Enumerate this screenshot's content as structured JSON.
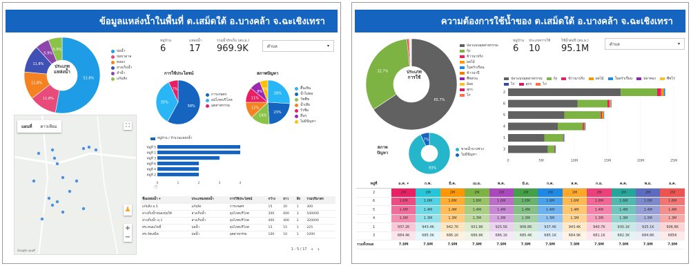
{
  "left": {
    "title": "ข้อมูลแหล่งน้ำในพื้นที่ ต.เสม็ดใต้ อ.บางคล้า จ.ฉะเชิงเทรา",
    "kpis": [
      {
        "label": "หมู่บ้าน",
        "value": "6"
      },
      {
        "label": "แหล่งน้ำ",
        "value": "17"
      },
      {
        "label": "รวมน้ำกักเก็บ (ลบ.ม.)",
        "value": "969.9K"
      }
    ],
    "filter_label": "ตำบล",
    "donut": {
      "center": [
        "ประเภท",
        "แหล่งน้ำ"
      ],
      "legend": [
        "บ่อน้ำ",
        "บ่อบาดาล",
        "คลอง",
        "อ่างเก็บน้ำ",
        "ลำน้ำ",
        "แก้มลิง"
      ],
      "colors": [
        "#1e9de6",
        "#e84a7a",
        "#f58220",
        "#3f51b5",
        "#8e44ad",
        "#8bc34a"
      ],
      "values": [
        52.9,
        11.8,
        11.8,
        11.8,
        5.9,
        5.9
      ]
    },
    "pie_use": {
      "title": "การใช้ประโยชน์",
      "legend": [
        "การเกษตร",
        "อุปโภคบริโภค",
        "อุตสาหกรรม"
      ],
      "colors": [
        "#1565c0",
        "#29b6f6",
        "#e91e63"
      ],
      "values": [
        58,
        35,
        7
      ]
    },
    "pie_problem": {
      "title": "สภาพปัญหา",
      "legend": [
        "ตื้นเขิน",
        "น้ำไม่พอ",
        "วัชพืช",
        "น้ำเสีย",
        "รั่วซึม",
        "อื่นๆ",
        "ไม่มีปัญหา"
      ],
      "colors": [
        "#29b6f6",
        "#1565c0",
        "#8bc34a",
        "#f58220",
        "#e91e63",
        "#9c27b0",
        "#ffc107"
      ],
      "values": [
        26,
        23,
        14,
        12,
        11,
        8,
        6
      ]
    },
    "bar": {
      "legend": "หมู่บ้าน / จำนวนแหล่งน้ำ",
      "categories": [
        "หมู่ที่ 5",
        "หมู่ที่ 1",
        "หมู่ที่ 3",
        "หมู่ที่ 6",
        "หมู่ที่ 4",
        "หมู่ที่ 2"
      ],
      "values": [
        4,
        4,
        3,
        2,
        2,
        2
      ],
      "ticks": [
        "0",
        "1",
        "2",
        "3",
        "4"
      ]
    },
    "map": {
      "tab_map": "แผนที่",
      "tab_sat": "ดาวเทียม",
      "footer": "Google แผนที่"
    },
    "table": {
      "headers": [
        "ชื่อแหล่งน้ำ ▾",
        "ประเภทแหล่งน้ำ",
        "การใช้ประโยชน์",
        "กว้าง",
        "ยาว",
        "ลึก",
        "รวมปริมาตร"
      ],
      "rows": [
        [
          "แก้มลิง ม.5",
          "แก้มลิง",
          "การเกษตร",
          "15",
          "20",
          "1",
          "300"
        ],
        [
          "อ่างเก็บน้ำหนองกุ่มใต้",
          "อ่างเก็บน้ำ",
          "อุปโภคบริโภค",
          "300",
          "600",
          "3",
          "540000"
        ],
        [
          "อ่างเก็บน้ำ ม.1",
          "อ่างเก็บน้ำ",
          "อุปโภคบริโภค",
          "400",
          "400",
          "2",
          "320000"
        ],
        [
          "สระหนองโพธิ์",
          "บ่อน้ำ",
          "อุปโภคบริโภค",
          "15",
          "15",
          "1",
          "225"
        ],
        [
          "สระวัดเสม็ด",
          "บ่อน้ำ",
          "อุตสาหกรรม",
          "100",
          "10",
          "1",
          "1000"
        ]
      ],
      "pager": "1 - 5 / 17"
    }
  },
  "right": {
    "title": "ความต้องการใช้น้ำของ ต.เสม็ดใต้ อ.บางคล้า จ.ฉะเชิงเทรา",
    "kpis": [
      {
        "label": "หมู่บ้าน",
        "value": "6"
      },
      {
        "label": "ประเภทการใช้",
        "value": "10"
      },
      {
        "label": "ใช้น้ำต่อปี (ลบ.ม.)",
        "value": "95.1M"
      }
    ],
    "filter_label": "ตำบล",
    "donut": {
      "center": [
        "ประเภท",
        "การใช้"
      ],
      "legend": [
        "ปลาแบบอุตสาหกรรม",
        "กุ้ง",
        "ข้าวนาปรัง",
        "ผลไม้",
        "ในครัวเรือน",
        "ข้าวนาปี",
        "พืชสวน",
        "อ้อย",
        "สุกร",
        "ไก่"
      ],
      "colors": [
        "#616161",
        "#7cb342",
        "#e91e63",
        "#ff9800",
        "#1e88e5",
        "#f57c00",
        "#8e24aa",
        "#fbc02d",
        "#d81b60",
        "#ff7043"
      ],
      "values": [
        65.7,
        32.7,
        0.6,
        0.4,
        0.2,
        0.1,
        0.1,
        0.1,
        0.05,
        0.05
      ]
    },
    "problem": {
      "center": [
        "สภาพ",
        "ปัญหา"
      ],
      "legend": [
        "ขาดน้ำบางช่วง",
        "ไม่มีปัญหา"
      ],
      "colors": [
        "#26b6cc",
        "#1565c0"
      ],
      "values": [
        93,
        7
      ]
    },
    "stack": {
      "categories": [
        "2",
        "6",
        "5",
        "4",
        "1",
        "3"
      ],
      "series": [
        {
          "name": "ปลาแบบอุตสาหกรรม",
          "values": [
            17,
            10.5,
            8.5,
            7.5,
            5.5,
            6
          ]
        },
        {
          "name": "กุ้ง",
          "values": [
            5.5,
            4.5,
            5.5,
            3.8,
            2.8,
            1.0
          ]
        },
        {
          "name": "ข้าวนาปรัง",
          "values": [
            0.6,
            0.3,
            0.2,
            0.2,
            0.1,
            0.1
          ]
        },
        {
          "name": "ผลไม้",
          "values": [
            0.4,
            0.2,
            0.2,
            0.1,
            0.0,
            0.0
          ]
        },
        {
          "name": "ในครัวเรือน",
          "values": [
            0.2,
            0.1,
            0.1,
            0.1,
            0.1,
            0.1
          ]
        }
      ],
      "legend": [
        "ปลาแบบอุตสาหกรรม",
        "กุ้ง",
        "ข้าวนาปรัง",
        "ผลไม้",
        "ในครัวเรือน",
        "ปลาทอง",
        "พืชไร่",
        "ไก่",
        "สุกร",
        "ไก่"
      ],
      "legend_colors": [
        "#616161",
        "#7cb342",
        "#e91e63",
        "#ff9800",
        "#1e88e5",
        "#8e24aa",
        "#fbc02d",
        "#3949ab",
        "#d81b60",
        "#ff7043"
      ],
      "colors": [
        "#616161",
        "#7cb342",
        "#e91e63",
        "#ff9800",
        "#1e88e5"
      ],
      "ticks": [
        "0",
        "5M",
        "10M",
        "15M",
        "20M",
        "25M"
      ],
      "xlim": [
        0,
        25
      ]
    },
    "monthly": {
      "headers": [
        "หมู่ที่",
        "ม.ค. ▾",
        "ก.พ.",
        "มี.ค.",
        "เม.ย.",
        "พ.ค.",
        "มิ.ย.",
        "ก.ค.",
        "ส.ค.",
        "ก.ย.",
        "ต.ค.",
        "พ.ย.",
        "ธ.ค."
      ],
      "rows": [
        {
          "id": "2",
          "vals": [
            "2M",
            "2M",
            "2M",
            "2M",
            "2M",
            "2M",
            "2M",
            "2M",
            "2M",
            "2M",
            "2M",
            "2M"
          ]
        },
        {
          "id": "6",
          "vals": [
            "1.6M",
            "1.6M",
            "1.6M",
            "1.6M",
            "1.6M",
            "1.6M",
            "1.6M",
            "1.6M",
            "1.6M",
            "1.6M",
            "1.6M",
            "1.6M"
          ]
        },
        {
          "id": "5",
          "vals": [
            "1.4M",
            "1.4M",
            "1.4M",
            "1.4M",
            "1.4M",
            "1.4M",
            "1.4M",
            "1.4M",
            "1.4M",
            "1.4M",
            "1.4M",
            "1.4M"
          ]
        },
        {
          "id": "4",
          "vals": [
            "1.3M",
            "1.3M",
            "1.3M",
            "1.3M",
            "1.3M",
            "1.3M",
            "1.3M",
            "1.3M",
            "1.3M",
            "1.3M",
            "1.3M",
            "1.3M"
          ]
        },
        {
          "id": "1",
          "vals": [
            "937.2K",
            "943.4K",
            "942.7K",
            "931.9K",
            "925.5K",
            "906.8K",
            "937.4K",
            "943.4K",
            "940.7K",
            "930.1K",
            "925.1K",
            "906.8K"
          ]
        },
        {
          "id": "3",
          "vals": [
            "684.4K",
            "685.3K",
            "686.1K",
            "686.9K",
            "686.1K",
            "685.4K",
            "685.1K",
            "684.9K",
            "681.1K",
            "682.3K",
            "684.8K",
            "685K"
          ]
        }
      ],
      "total_label": "รวมทั้งหมด",
      "totals": [
        "7.9M",
        "7.9M",
        "7.9M",
        "7.9M",
        "7.9M",
        "7.9M",
        "7.9M",
        "7.9M",
        "7.9M",
        "7.9M",
        "7.9M",
        "7.9M"
      ],
      "heat_colors": [
        "#e91e63",
        "#26c6da",
        "#ff9800",
        "#7cb342",
        "#ab47bc",
        "#43a047",
        "#1e88e5",
        "#ffa726",
        "#ec407a",
        "#26a69a",
        "#5c6bc0",
        "#ef5350"
      ]
    }
  }
}
